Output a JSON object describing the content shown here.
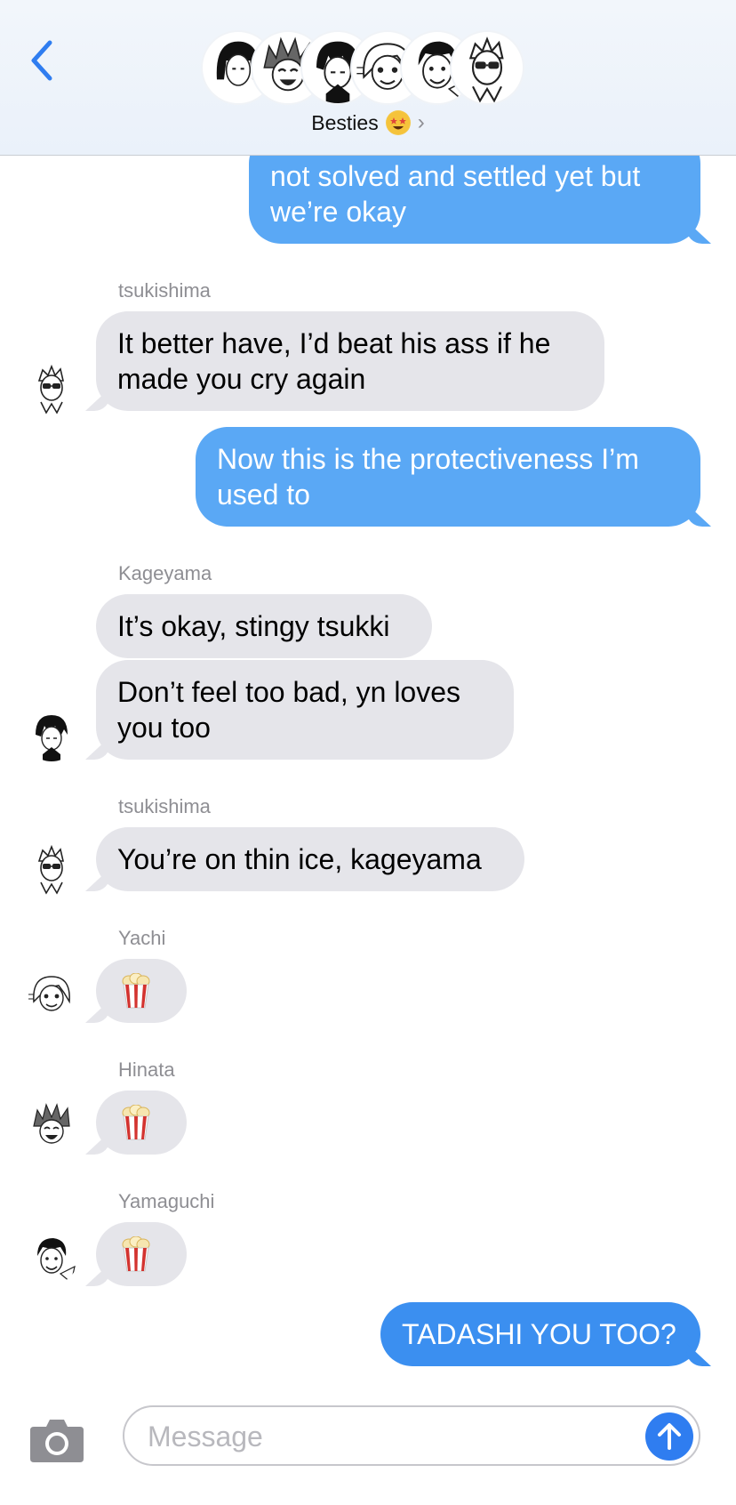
{
  "header": {
    "group_name": "Besties",
    "group_emoji": "star-struck-emoji",
    "chevron": "›",
    "avatar_count": 6
  },
  "messages": [
    {
      "from": "me",
      "text": "not solved and settled yet but we’re okay"
    },
    {
      "from": "tsukishima",
      "sender_label": "tsukishima",
      "text": "It better have, I’d beat his ass if he made you cry again"
    },
    {
      "from": "me",
      "text": "Now this is the protectiveness I’m used to"
    },
    {
      "from": "kageyama",
      "sender_label": "Kageyama",
      "text": "It’s okay, stingy tsukki"
    },
    {
      "from": "kageyama",
      "text": "Don’t feel too bad, yn loves you too"
    },
    {
      "from": "tsukishima",
      "sender_label": "tsukishima",
      "text": "You’re on thin ice, kageyama"
    },
    {
      "from": "yachi",
      "sender_label": "Yachi",
      "emoji": "popcorn-emoji"
    },
    {
      "from": "hinata",
      "sender_label": "Hinata",
      "emoji": "popcorn-emoji"
    },
    {
      "from": "yamaguchi",
      "sender_label": "Yamaguchi",
      "emoji": "popcorn-emoji"
    },
    {
      "from": "me",
      "text": "TADASHI YOU TOO?"
    }
  ],
  "composer": {
    "placeholder": "Message"
  },
  "colors": {
    "outgoing_bubble": "#5aa8f5",
    "outgoing_bubble_latest": "#3b8ff0",
    "incoming_bubble": "#e5e5ea",
    "accent": "#2f7df0"
  }
}
